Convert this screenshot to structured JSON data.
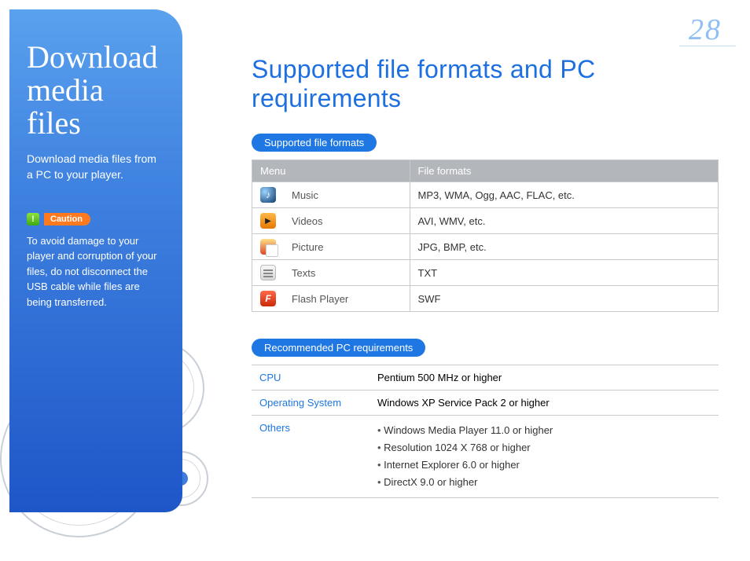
{
  "page_number": "28",
  "sidebar": {
    "title": "Download media files",
    "subtitle": "Download media files from a PC to your player.",
    "caution_label": "Caution",
    "caution_body": "To avoid damage to your player and corruption of your files, do not disconnect the USB cable while files are being transferred."
  },
  "main": {
    "heading": "Supported file formats and PC requirements",
    "formats_pill": "Supported file formats",
    "formats_table": {
      "head_menu": "Menu",
      "head_formats": "File formats",
      "rows": [
        {
          "icon": "music",
          "name": "Music",
          "formats": "MP3, WMA, Ogg, AAC, FLAC, etc."
        },
        {
          "icon": "video",
          "name": "Videos",
          "formats": "AVI, WMV, etc."
        },
        {
          "icon": "pic",
          "name": "Picture",
          "formats": "JPG, BMP, etc."
        },
        {
          "icon": "text",
          "name": "Texts",
          "formats": "TXT"
        },
        {
          "icon": "flash",
          "name": "Flash Player",
          "formats": "SWF"
        }
      ]
    },
    "req_pill": "Recommended PC requirements",
    "req_table": {
      "cpu_label": "CPU",
      "cpu_value": "Pentium 500 MHz or higher",
      "os_label": "Operating System",
      "os_value": "Windows XP Service Pack 2 or higher",
      "others_label": "Others",
      "others_items": [
        "Windows Media Player 11.0 or higher",
        "Resolution 1024 X 768 or higher",
        "Internet Explorer 6.0 or higher",
        "DirectX 9.0 or higher"
      ]
    }
  }
}
